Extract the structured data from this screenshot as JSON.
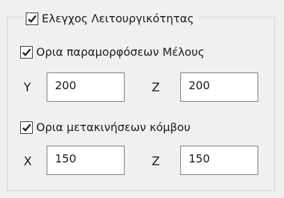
{
  "group": {
    "enabled": true,
    "title": "Ελεγχος Λειτουργικότητας"
  },
  "member_limits": {
    "enabled": true,
    "label": "Ορια παραμορφόσεων Μέλους",
    "fields": [
      {
        "axis": "Y",
        "value": "200"
      },
      {
        "axis": "Z",
        "value": "200"
      }
    ]
  },
  "node_limits": {
    "enabled": true,
    "label": "Ορια μετακινήσεων κόμβου",
    "fields": [
      {
        "axis": "X",
        "value": "150"
      },
      {
        "axis": "Z",
        "value": "150"
      }
    ]
  }
}
